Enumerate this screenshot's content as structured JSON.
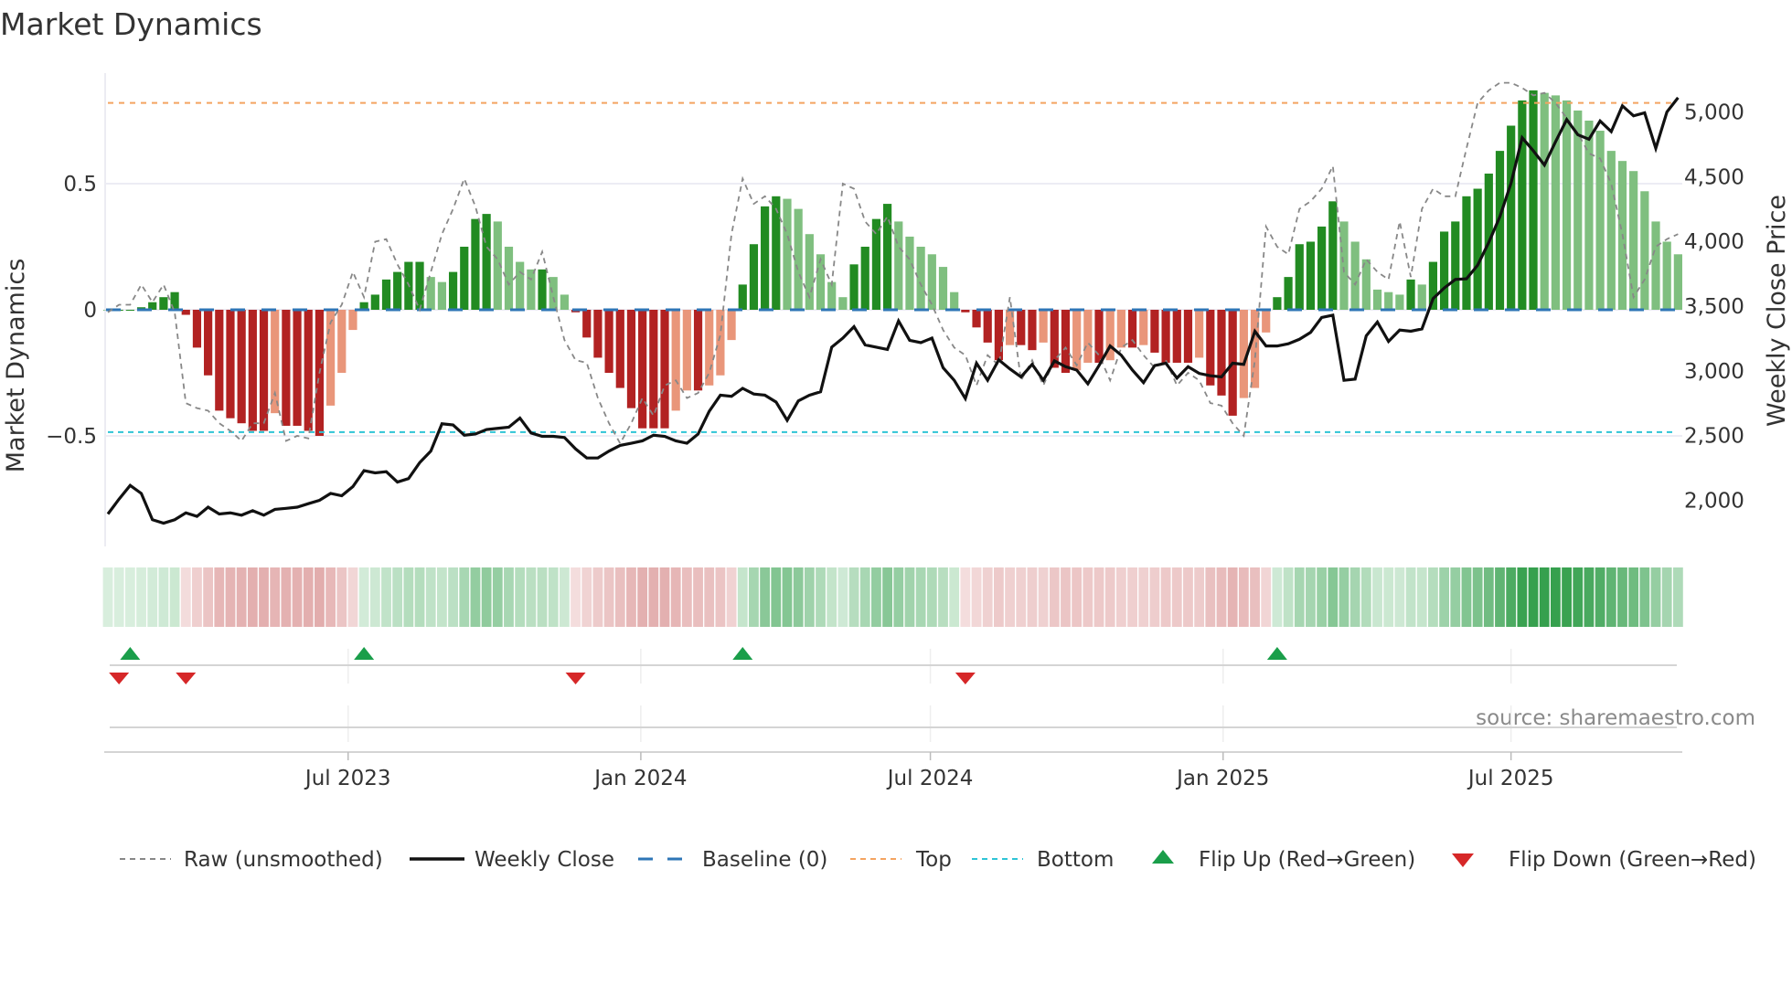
{
  "chart_data": {
    "type": "bar",
    "title": "Market Dynamics",
    "ylabel": "Market Dynamics",
    "y2label": "Weekly Close Price",
    "source": "source: sharemaestro.com",
    "x_start": "2023-01-31",
    "x_step_days": 7,
    "ylim": [
      -0.95,
      0.98
    ],
    "y2lim": [
      1500,
      5350
    ],
    "yticks": [
      {
        "value": 0.5,
        "label": "0.5"
      },
      {
        "value": 0,
        "label": "0"
      },
      {
        "value": -0.5,
        "label": "−0.5"
      }
    ],
    "y2ticks": [
      {
        "value": 2000,
        "label": "2,000"
      },
      {
        "value": 2500,
        "label": "2,500"
      },
      {
        "value": 3000,
        "label": "3,000"
      },
      {
        "value": 3500,
        "label": "3,500"
      },
      {
        "value": 4000,
        "label": "4,000"
      },
      {
        "value": 4500,
        "label": "4,500"
      },
      {
        "value": 5000,
        "label": "5,000"
      }
    ],
    "xticks": [
      {
        "date": "2023-07-01",
        "label": "Jul 2023"
      },
      {
        "date": "2024-01-01",
        "label": "Jan 2024"
      },
      {
        "date": "2024-07-01",
        "label": "Jul 2024"
      },
      {
        "date": "2025-01-01",
        "label": "Jan 2025"
      },
      {
        "date": "2025-07-01",
        "label": "Jul 2025"
      }
    ],
    "top_level": 0.82,
    "bottom_level": -0.485,
    "baseline": 0,
    "smoothed": [
      0,
      0,
      0,
      0.01,
      0.03,
      0.05,
      0.07,
      -0.02,
      -0.15,
      -0.26,
      -0.4,
      -0.43,
      -0.45,
      -0.48,
      -0.48,
      -0.41,
      -0.46,
      -0.46,
      -0.48,
      -0.5,
      -0.38,
      -0.25,
      -0.08,
      0.03,
      0.06,
      0.12,
      0.15,
      0.19,
      0.19,
      0.13,
      0.11,
      0.15,
      0.25,
      0.36,
      0.38,
      0.35,
      0.25,
      0.19,
      0.16,
      0.16,
      0.13,
      0.06,
      -0.01,
      -0.11,
      -0.19,
      -0.25,
      -0.31,
      -0.39,
      -0.47,
      -0.47,
      -0.47,
      -0.4,
      -0.32,
      -0.32,
      -0.3,
      -0.26,
      -0.12,
      0.1,
      0.26,
      0.41,
      0.45,
      0.44,
      0.4,
      0.3,
      0.22,
      0.11,
      0.05,
      0.18,
      0.25,
      0.36,
      0.42,
      0.35,
      0.29,
      0.25,
      0.22,
      0.17,
      0.07,
      -0.01,
      -0.07,
      -0.13,
      -0.2,
      -0.14,
      -0.14,
      -0.16,
      -0.13,
      -0.23,
      -0.25,
      -0.24,
      -0.21,
      -0.21,
      -0.2,
      -0.15,
      -0.15,
      -0.14,
      -0.17,
      -0.21,
      -0.21,
      -0.21,
      -0.19,
      -0.3,
      -0.34,
      -0.42,
      -0.35,
      -0.31,
      -0.09,
      0.05,
      0.13,
      0.26,
      0.27,
      0.33,
      0.43,
      0.35,
      0.27,
      0.2,
      0.08,
      0.07,
      0.06,
      0.12,
      0.1,
      0.19,
      0.31,
      0.35,
      0.45,
      0.48,
      0.54,
      0.63,
      0.73,
      0.83,
      0.87,
      0.86,
      0.85,
      0.83,
      0.79,
      0.75,
      0.71,
      0.63,
      0.59,
      0.55,
      0.47,
      0.35,
      0.27,
      0.22
    ],
    "raw": [
      -0.01,
      0.02,
      0.02,
      0.1,
      0.03,
      0.1,
      -0.01,
      -0.37,
      -0.39,
      -0.4,
      -0.45,
      -0.48,
      -0.52,
      -0.45,
      -0.45,
      -0.33,
      -0.52,
      -0.5,
      -0.51,
      -0.25,
      -0.05,
      0.02,
      0.15,
      0.05,
      0.27,
      0.28,
      0.18,
      0.1,
      0.0,
      0.15,
      0.3,
      0.4,
      0.52,
      0.41,
      0.25,
      0.2,
      0.1,
      0.15,
      0.12,
      0.23,
      0.05,
      -0.12,
      -0.2,
      -0.21,
      -0.35,
      -0.45,
      -0.53,
      -0.45,
      -0.35,
      -0.42,
      -0.3,
      -0.28,
      -0.35,
      -0.33,
      -0.25,
      -0.1,
      0.3,
      0.52,
      0.42,
      0.45,
      0.4,
      0.3,
      0.15,
      0.05,
      0.2,
      0.1,
      0.5,
      0.48,
      0.35,
      0.3,
      0.37,
      0.25,
      0.2,
      0.1,
      0.02,
      -0.08,
      -0.15,
      -0.18,
      -0.3,
      -0.18,
      -0.22,
      0.05,
      -0.28,
      -0.2,
      -0.3,
      -0.2,
      -0.15,
      -0.22,
      -0.13,
      -0.18,
      -0.28,
      -0.15,
      -0.12,
      -0.18,
      -0.23,
      -0.2,
      -0.3,
      -0.25,
      -0.28,
      -0.37,
      -0.38,
      -0.45,
      -0.5,
      -0.2,
      0.33,
      0.25,
      0.22,
      0.4,
      0.43,
      0.48,
      0.57,
      0.15,
      0.1,
      0.2,
      0.15,
      0.12,
      0.35,
      0.13,
      0.4,
      0.48,
      0.45,
      0.45,
      0.64,
      0.82,
      0.87,
      0.9,
      0.9,
      0.88,
      0.85,
      0.86,
      0.82,
      0.76,
      0.7,
      0.62,
      0.6,
      0.5,
      0.3,
      0.05,
      0.12,
      0.25,
      0.28,
      0.3
    ],
    "weekly_close": [
      1894,
      2009,
      2115,
      2053,
      1850,
      1823,
      1850,
      1903,
      1876,
      1947,
      1894,
      1903,
      1885,
      1920,
      1885,
      1930,
      1938,
      1947,
      1974,
      2000,
      2053,
      2035,
      2106,
      2229,
      2212,
      2221,
      2141,
      2168,
      2291,
      2380,
      2591,
      2582,
      2503,
      2512,
      2547,
      2556,
      2565,
      2635,
      2520,
      2494,
      2494,
      2485,
      2397,
      2327,
      2327,
      2380,
      2424,
      2441,
      2459,
      2503,
      2494,
      2459,
      2441,
      2512,
      2688,
      2812,
      2803,
      2865,
      2821,
      2812,
      2759,
      2618,
      2768,
      2812,
      2838,
      3183,
      3253,
      3341,
      3200,
      3183,
      3165,
      3386,
      3236,
      3218,
      3253,
      3024,
      2927,
      2786,
      3059,
      2927,
      3085,
      3015,
      2953,
      3050,
      2927,
      3077,
      3032,
      3006,
      2900,
      3041,
      3192,
      3121,
      3006,
      2909,
      3041,
      3059,
      2944,
      3032,
      2980,
      2962,
      2953,
      3059,
      3050,
      3306,
      3192,
      3192,
      3209,
      3244,
      3297,
      3412,
      3430,
      2927,
      2936,
      3271,
      3377,
      3227,
      3315,
      3306,
      3324,
      3558,
      3640,
      3706,
      3711,
      3816,
      3992,
      4191,
      4449,
      4801,
      4700,
      4590,
      4770,
      4941,
      4824,
      4789,
      4930,
      4848,
      5047,
      4970,
      4993,
      4719,
      5000,
      5110
    ],
    "flip_up_weeks": [
      2,
      23,
      57,
      105
    ],
    "flip_down_weeks": [
      1,
      7,
      42,
      77
    ],
    "colors": {
      "up_strong": "#228b22",
      "up_weak": "#7fbf7f",
      "down_strong": "#b22222",
      "down_weak": "#e9967a",
      "raw": "#888888",
      "close": "#111111",
      "baseline": "#2e75b6",
      "top": "#f4a460",
      "bottom": "#2ec4d6",
      "flip_up": "#1a9e4a",
      "flip_down": "#d62728"
    },
    "legend": {
      "placement": "bottom",
      "items": [
        {
          "key": "raw",
          "label": "Raw (unsmoothed)"
        },
        {
          "key": "close",
          "label": "Weekly Close"
        },
        {
          "key": "baseline",
          "label": "Baseline (0)"
        },
        {
          "key": "top",
          "label": "Top"
        },
        {
          "key": "bottom",
          "label": "Bottom"
        },
        {
          "key": "flip_up",
          "label": "Flip Up (Red→Green)"
        },
        {
          "key": "flip_down",
          "label": "Flip Down (Green→Red)"
        }
      ]
    }
  }
}
